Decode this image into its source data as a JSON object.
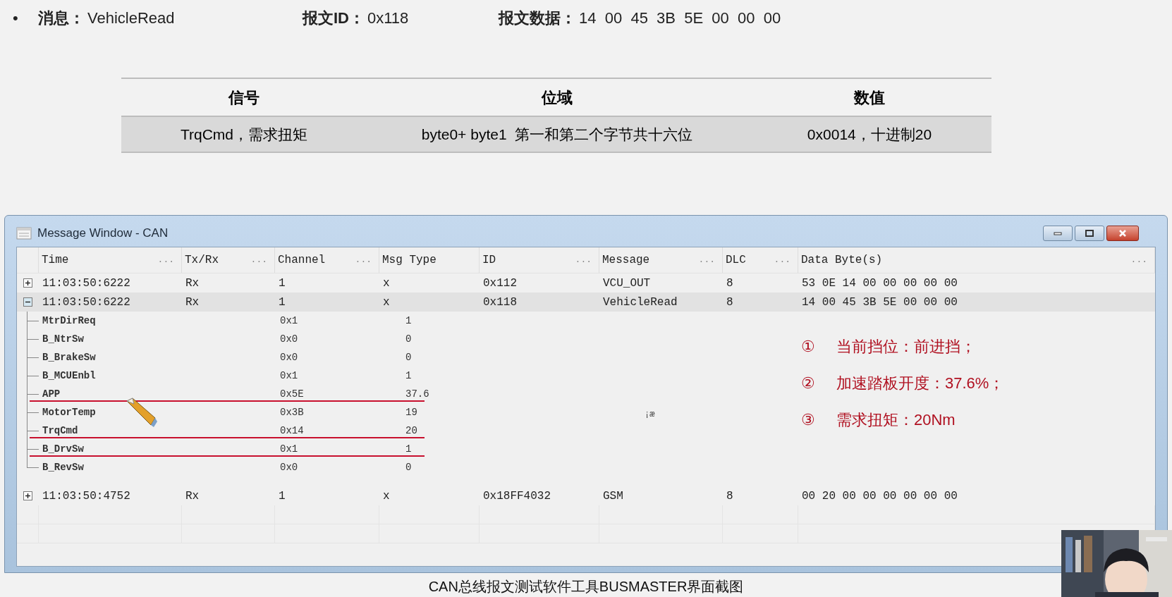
{
  "header_line": {
    "marker": "•",
    "items": [
      {
        "label": "消息：",
        "value": "VehicleRead"
      },
      {
        "label": "报文ID：",
        "value": "0x118"
      },
      {
        "label": "报文数据：",
        "value": "14  00  45  3B  5E  00  00  00"
      }
    ]
  },
  "signal_table": {
    "columns": [
      "信号",
      "位域",
      "数值"
    ],
    "rows": [
      [
        "TrqCmd，需求扭矩",
        "byte0+ byte1  第一和第二个字节共十六位",
        "0x0014，十进制20"
      ]
    ]
  },
  "window": {
    "title": "Message Window - CAN",
    "columns": [
      {
        "label": "Time",
        "dots": "..."
      },
      {
        "label": "Tx/Rx",
        "dots": "..."
      },
      {
        "label": "Channel",
        "dots": "..."
      },
      {
        "label": "Msg Type"
      },
      {
        "label": "ID",
        "dots": "..."
      },
      {
        "label": "Message",
        "dots": "..."
      },
      {
        "label": "DLC",
        "dots": "..."
      },
      {
        "label": "Data Byte(s)",
        "dots": "..."
      }
    ],
    "rows": [
      {
        "time": "11:03:50:6222",
        "txrx": "Rx",
        "channel": "1",
        "type": "x",
        "id": "0x112",
        "message": "VCU_OUT",
        "dlc": "8",
        "data": "53 0E 14 00 00 00 00 00",
        "expanded": false,
        "selected": false
      },
      {
        "time": "11:03:50:6222",
        "txrx": "Rx",
        "channel": "1",
        "type": "x",
        "id": "0x118",
        "message": "VehicleRead",
        "dlc": "8",
        "data": "14 00 45 3B 5E 00 00 00",
        "expanded": true,
        "selected": true,
        "children": [
          {
            "name": "MtrDirReq",
            "raw": "0x1",
            "value": "1",
            "underlined": false
          },
          {
            "name": "B_NtrSw",
            "raw": "0x0",
            "value": "0",
            "underlined": false
          },
          {
            "name": "B_BrakeSw",
            "raw": "0x0",
            "value": "0",
            "underlined": false
          },
          {
            "name": "B_MCUEnbl",
            "raw": "0x1",
            "value": "1",
            "underlined": false
          },
          {
            "name": "APP",
            "raw": "0x5E",
            "value": "37.6",
            "underlined": true
          },
          {
            "name": "MotorTemp",
            "raw": "0x3B",
            "value": "19",
            "underlined": false
          },
          {
            "name": "TrqCmd",
            "raw": "0x14",
            "value": "20",
            "underlined": true
          },
          {
            "name": "B_DrvSw",
            "raw": "0x1",
            "value": "1",
            "underlined": true
          },
          {
            "name": "B_RevSw",
            "raw": "0x0",
            "value": "0",
            "underlined": false
          }
        ]
      },
      {
        "time": "11:03:50:4752",
        "txrx": "Rx",
        "channel": "1",
        "type": "x",
        "id": "0x18FF4032",
        "message": "GSM",
        "dlc": "8",
        "data": "00 20 00 00 00 00 00 00",
        "expanded": false,
        "selected": false
      }
    ],
    "stray_text": "¡æ",
    "annotations": [
      {
        "marker": "①",
        "text": "当前挡位：前进挡；"
      },
      {
        "marker": "②",
        "text": "加速踏板开度：37.6%；"
      },
      {
        "marker": "③",
        "text": "需求扭矩：20Nm"
      }
    ]
  },
  "caption": "CAN总线报文测试软件工具BUSMASTER界面截图"
}
